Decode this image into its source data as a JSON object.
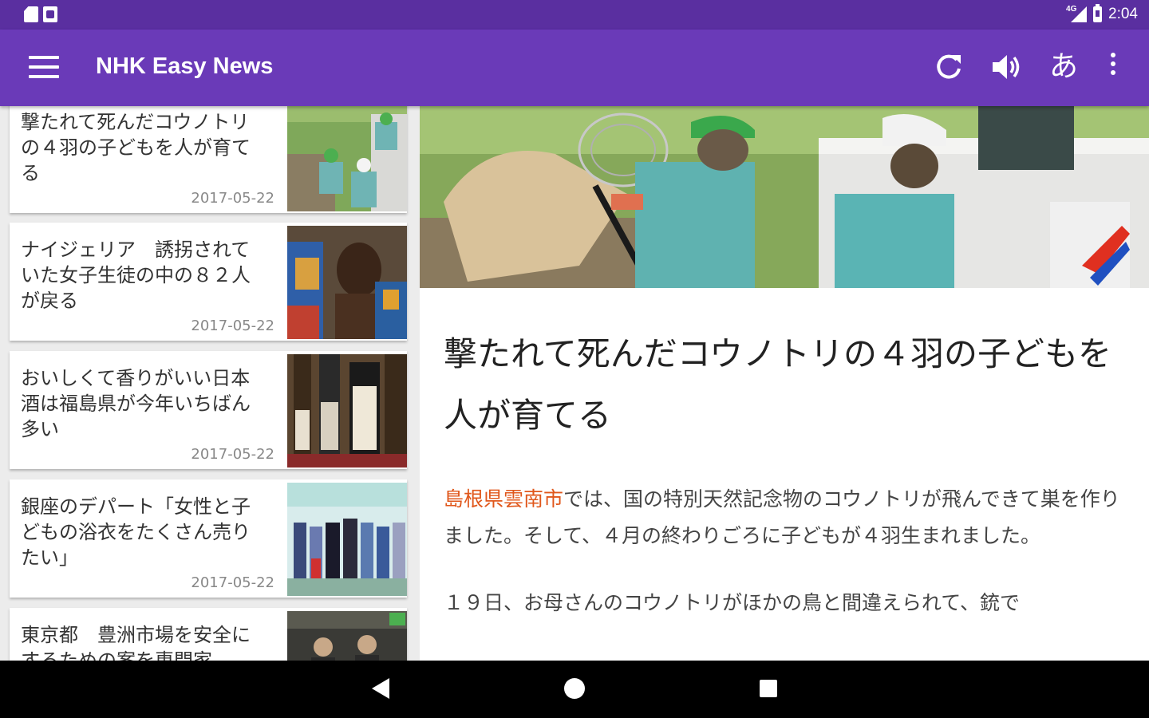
{
  "status_bar": {
    "time": "2:04",
    "network": "4G",
    "icons": [
      "sd-card-icon",
      "photo-icon",
      "signal-icon",
      "battery-icon"
    ]
  },
  "app_bar": {
    "title": "NHK Easy News",
    "kana_label": "あ",
    "icons": [
      "menu-icon",
      "refresh-icon",
      "volume-icon",
      "kana-toggle-icon",
      "overflow-menu-icon"
    ]
  },
  "articles": [
    {
      "title": "撃たれて死んだコウノトリの４羽の子どもを人が育てる",
      "date": "2017-05-22"
    },
    {
      "title": "ナイジェリア　誘拐されていた女子生徒の中の８２人が戻る",
      "date": "2017-05-22"
    },
    {
      "title": "おいしくて香りがいい日本酒は福島県が今年いちばん多い",
      "date": "2017-05-22"
    },
    {
      "title": "銀座のデパート「女性と子どもの浴衣をたくさん売りたい」",
      "date": "2017-05-22"
    },
    {
      "title": "東京都　豊洲市場を安全にするための案を専門家",
      "date": ""
    }
  ],
  "detail": {
    "title": "撃たれて死んだコウノトリの４羽の子どもを人が育てる",
    "p1_link": "島根県雲南市",
    "p1_rest": "では、国の特別天然記念物のコウノトリが飛んできて巣を作りました。そして、４月の終わりごろに子どもが４羽生まれました。",
    "p2": "１９日、お母さんのコウノトリがほかの鳥と間違えられて、銃で"
  },
  "colors": {
    "status_bar": "#5a2fa0",
    "app_bar": "#6a3ab8",
    "link": "#e0571b",
    "date": "#888888"
  }
}
